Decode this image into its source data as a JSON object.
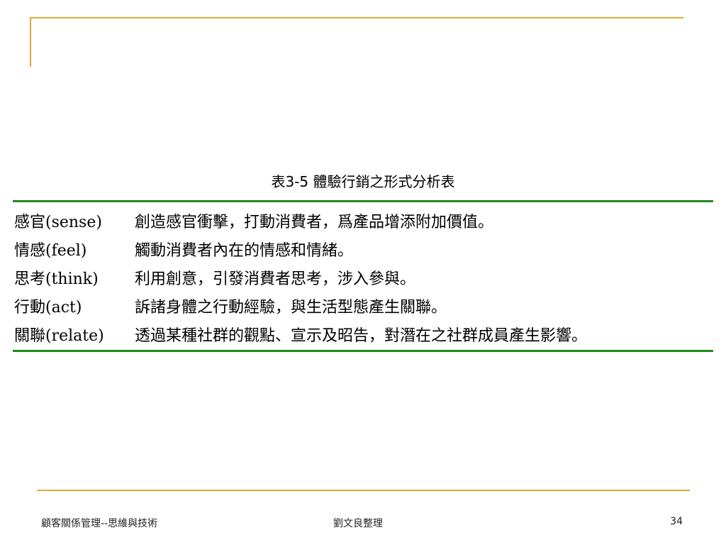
{
  "slide": {
    "caption": "表3-5  體驗行銷之形式分析表",
    "rows": [
      {
        "term": "感官(sense)",
        "desc": "創造感官衝擊，打動消費者，爲產品增添附加價值。"
      },
      {
        "term": "情感(feel)",
        "desc": "觸動消費者內在的情感和情緒。"
      },
      {
        "term": "思考(think)",
        "desc": "利用創意，引發消費者思考，涉入參與。"
      },
      {
        "term": "行動(act)",
        "desc": "訴諸身體之行動經驗，與生活型態產生關聯。"
      },
      {
        "term": "關聯(relate)",
        "desc": "透過某種社群的觀點、宣示及昭告，對潛在之社群成員產生影響。"
      }
    ]
  },
  "footer": {
    "left": "顧客關係管理--思維與技術",
    "center": "劉文良整理",
    "page_number": "34"
  },
  "colors": {
    "accent_line": "#e0a934",
    "table_rule": "#1e8a1e"
  }
}
